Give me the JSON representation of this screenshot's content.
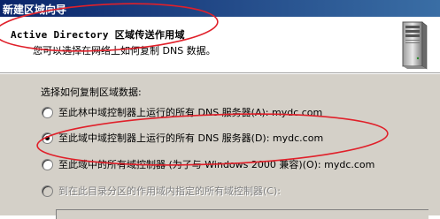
{
  "window": {
    "title": "新建区域向导"
  },
  "header": {
    "title": "Active Directory 区域传送作用域",
    "subtitle": "您可以选择在网络上如何复制 DNS 数据。",
    "icon": "server-icon"
  },
  "prompt": "选择如何复制区域数据:",
  "options": [
    {
      "label": "至此林中域控制器上运行的所有 DNS 服务器(A): mydc.com",
      "checked": false,
      "enabled": true
    },
    {
      "label": "至此域中域控制器上运行的所有 DNS 服务器(D): mydc.com",
      "checked": true,
      "enabled": true
    },
    {
      "label": "至此域中的所有域控制器 (为了与 Windows 2000 兼容)(O): mydc.com",
      "checked": false,
      "enabled": true
    },
    {
      "label": "到在此目录分区的作用域内指定的所有域控制器(C):",
      "checked": false,
      "enabled": false
    }
  ],
  "annotation_color": "#e0202a"
}
